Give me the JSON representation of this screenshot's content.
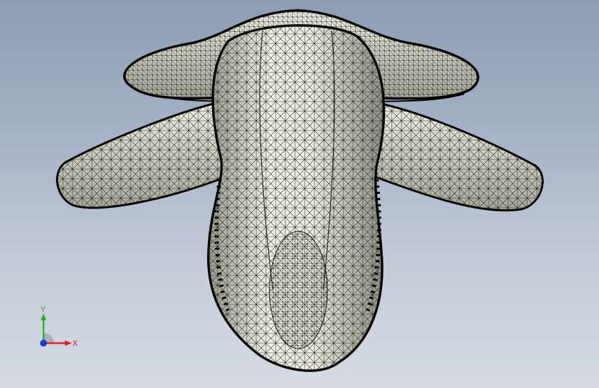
{
  "viewport": {
    "background_top": "#8b9cb4",
    "background_bottom": "#d6dbe4",
    "model": {
      "render_mode": "wireframe-shaded",
      "fill_color": "#e3e3d6",
      "mesh_color": "#111111"
    }
  },
  "triad": {
    "x_label": "X",
    "y_label": "Y",
    "x_color": "#e0201a",
    "y_color": "#28b028",
    "z_color": "#1f3bd0"
  }
}
